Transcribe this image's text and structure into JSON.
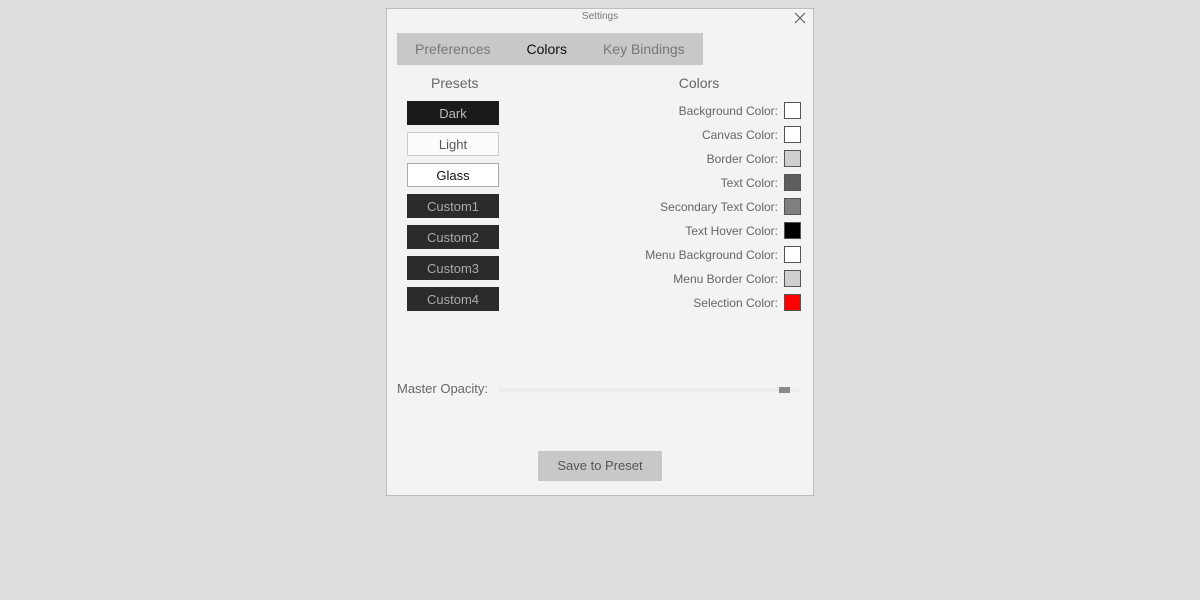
{
  "window": {
    "title": "Settings"
  },
  "tabs": [
    {
      "label": "Preferences",
      "active": false
    },
    {
      "label": "Colors",
      "active": true
    },
    {
      "label": "Key Bindings",
      "active": false
    }
  ],
  "presets": {
    "heading": "Presets",
    "items": [
      {
        "label": "Dark",
        "style": "dark"
      },
      {
        "label": "Light",
        "style": "light"
      },
      {
        "label": "Glass",
        "style": "glass"
      },
      {
        "label": "Custom1",
        "style": "custom"
      },
      {
        "label": "Custom2",
        "style": "custom"
      },
      {
        "label": "Custom3",
        "style": "custom"
      },
      {
        "label": "Custom4",
        "style": "custom"
      }
    ]
  },
  "colors": {
    "heading": "Colors",
    "items": [
      {
        "label": "Background Color:",
        "value": "#ffffff"
      },
      {
        "label": "Canvas Color:",
        "value": "#ffffff"
      },
      {
        "label": "Border Color:",
        "value": "#cfcfcf"
      },
      {
        "label": "Text Color:",
        "value": "#5e5e5e"
      },
      {
        "label": "Secondary Text Color:",
        "value": "#7f7f7f"
      },
      {
        "label": "Text Hover Color:",
        "value": "#000000"
      },
      {
        "label": "Menu Background Color:",
        "value": "#ffffff"
      },
      {
        "label": "Menu Border Color:",
        "value": "#cfcfcf"
      },
      {
        "label": "Selection Color:",
        "value": "#ff0000"
      }
    ]
  },
  "opacity": {
    "label": "Master Opacity:",
    "value": 0.97
  },
  "save": {
    "label": "Save to Preset"
  }
}
